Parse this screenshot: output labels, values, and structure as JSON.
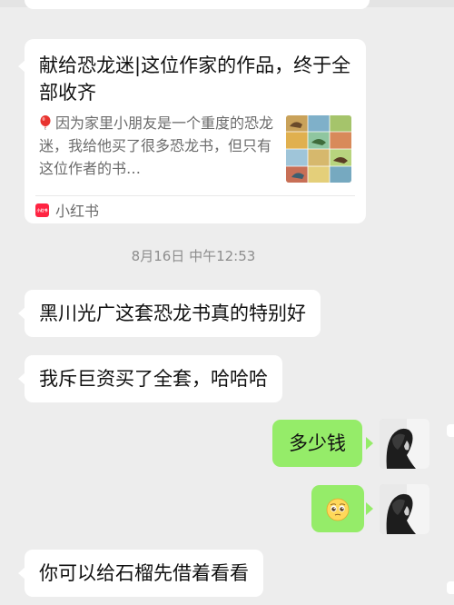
{
  "share_card": {
    "title": "献给恐龙迷|这位作家的作品，终于全部收齐",
    "description": "因为家里小朋友是一个重度的恐龙迷，我给他买了很多恐龙书，但只有这位作者的书…",
    "source_logo_text": "小红书",
    "source_label": "小红书"
  },
  "timestamp": "8月16日 中午12:53",
  "messages": [
    {
      "side": "left",
      "text": "黑川光广这套恐龙书真的特别好"
    },
    {
      "side": "left",
      "text": "我斥巨资买了全套，哈哈哈"
    },
    {
      "side": "right",
      "text": "多少钱"
    },
    {
      "side": "right",
      "text": "",
      "icon": "pleading-face-emoji"
    },
    {
      "side": "left",
      "text": "你可以给石榴先借着看看"
    }
  ],
  "colors": {
    "background": "#ededed",
    "incoming_bubble": "#ffffff",
    "outgoing_bubble": "#95ec69",
    "xiaohongshu_red": "#ff2442"
  }
}
